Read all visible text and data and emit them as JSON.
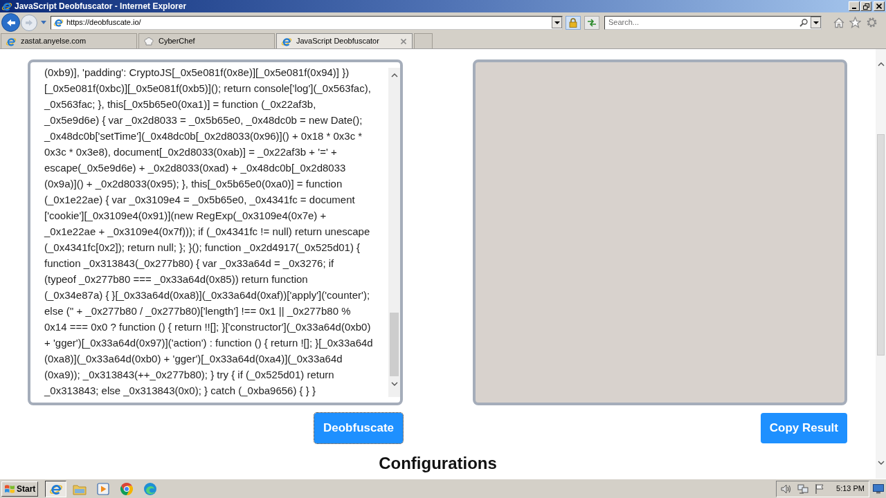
{
  "window": {
    "title": "JavaScript Deobfuscator - Internet Explorer"
  },
  "address_bar": {
    "url": "https://deobfuscate.io/"
  },
  "search": {
    "placeholder": "Search..."
  },
  "tabs": [
    {
      "kind": "page",
      "label": "zastat.anyelse.com",
      "selected": false
    },
    {
      "kind": "tool",
      "label": "CyberChef",
      "selected": false
    },
    {
      "kind": "page",
      "label": "JavaScript Deobfuscator",
      "selected": true
    }
  ],
  "editor": {
    "lines": [
      "(0xb9)], 'padding': CryptoJS[_0x5e081f(0x8e)][_0x5e081f(0x94)] })",
      "[_0x5e081f(0xbc)][_0x5e081f(0xb5)](); return console['log'](_0x563fac),",
      "_0x563fac; }, this[_0x5b65e0(0xa1)] = function (_0x22af3b,",
      "_0x5e9d6e) { var _0x2d8033 = _0x5b65e0, _0x48dc0b = new Date();",
      "_0x48dc0b['setTime'](_0x48dc0b[_0x2d8033(0x96)]() + 0x18 * 0x3c *",
      "0x3c * 0x3e8), document[_0x2d8033(0xab)] = _0x22af3b + '=' +",
      "escape(_0x5e9d6e) + _0x2d8033(0xad) + _0x48dc0b[_0x2d8033",
      "(0x9a)]() + _0x2d8033(0x95); }, this[_0x5b65e0(0xa0)] = function",
      "(_0x1e22ae) { var _0x3109e4 = _0x5b65e0, _0x4341fc = document",
      "['cookie'][_0x3109e4(0x91)](new RegExp(_0x3109e4(0x7e) +",
      "_0x1e22ae + _0x3109e4(0x7f))); if (_0x4341fc != null) return unescape",
      "(_0x4341fc[0x2]); return null; }; }(); function _0x2d4917(_0x525d01) {",
      "function _0x313843(_0x277b80) { var _0x33a64d = _0x3276; if",
      "(typeof _0x277b80 === _0x33a64d(0x85)) return function",
      "(_0x34e87a) { }[_0x33a64d(0xa8)](_0x33a64d(0xaf))['apply']('counter');",
      "else ('' + _0x277b80 / _0x277b80)['length'] !== 0x1 || _0x277b80 %",
      "0x14 === 0x0 ? function () { return !![]; }['constructor'](_0x33a64d(0xb0)",
      "+ 'gger')[_0x33a64d(0x97)]('action') : function () { return ![]; }[_0x33a64d",
      "(0xa8)](_0x33a64d(0xb0) + 'gger')[_0x33a64d(0xa4)](_0x33a64d",
      "(0xa9)); _0x313843(++_0x277b80); } try { if (_0x525d01) return",
      "_0x313843; else _0x313843(0x0); } catch (_0xba9656) { } }"
    ]
  },
  "buttons": [
    {
      "label": "Deobfuscate",
      "focused": true
    },
    {
      "label": "Copy Result",
      "focused": false
    }
  ],
  "heading": "Configurations",
  "taskbar": {
    "start": "Start",
    "items": [
      {
        "kind": "ie",
        "selected": true
      },
      {
        "kind": "folder",
        "selected": false
      },
      {
        "kind": "player",
        "selected": false
      },
      {
        "kind": "chrome",
        "selected": false
      },
      {
        "kind": "edge",
        "selected": false
      }
    ],
    "clock": "5:13 PM"
  }
}
